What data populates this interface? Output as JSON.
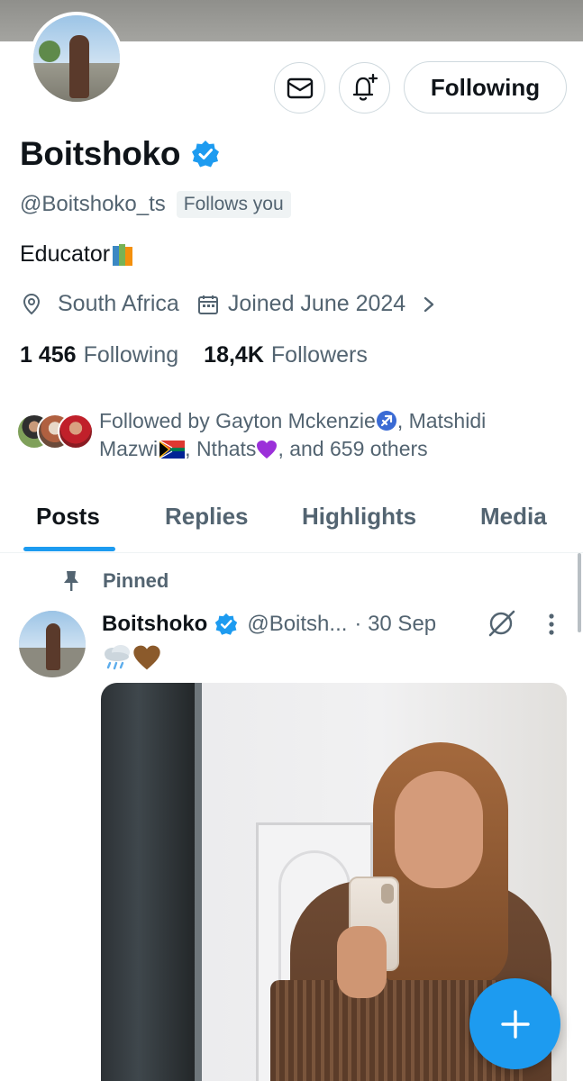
{
  "profile": {
    "display_name": "Boitshoko",
    "handle": "@Boitshoko_ts",
    "follows_you": "Follows you",
    "bio": "Educator",
    "location": "South Africa",
    "joined": "Joined June 2024",
    "following_count": "1 456",
    "following_label": "Following",
    "followers_count": "18,4K",
    "followers_label": "Followers",
    "following_button": "Following"
  },
  "followed_by": {
    "prefix": "Followed by Gayton Mckenzie",
    "name2_part1": ", Matshidi",
    "name2_part2": "Mazwi",
    "name3": ", Nthats",
    "suffix": ", and 659 others"
  },
  "tabs": [
    "Posts",
    "Replies",
    "Highlights",
    "Media"
  ],
  "post": {
    "pinned_label": "Pinned",
    "author_name": "Boitshoko",
    "author_handle": "@Boitsh...",
    "date": "· 30 Sep"
  },
  "colors": {
    "accent": "#1d9bf0",
    "verified": "#1d9bf0",
    "text_primary": "#0f1419",
    "text_secondary": "#536471"
  },
  "icons": [
    "mail-icon",
    "notification-add-icon",
    "verified-badge-icon",
    "location-icon",
    "calendar-icon",
    "chevron-right-icon",
    "pin-icon",
    "grok-icon",
    "more-icon",
    "compose-plus-icon"
  ]
}
